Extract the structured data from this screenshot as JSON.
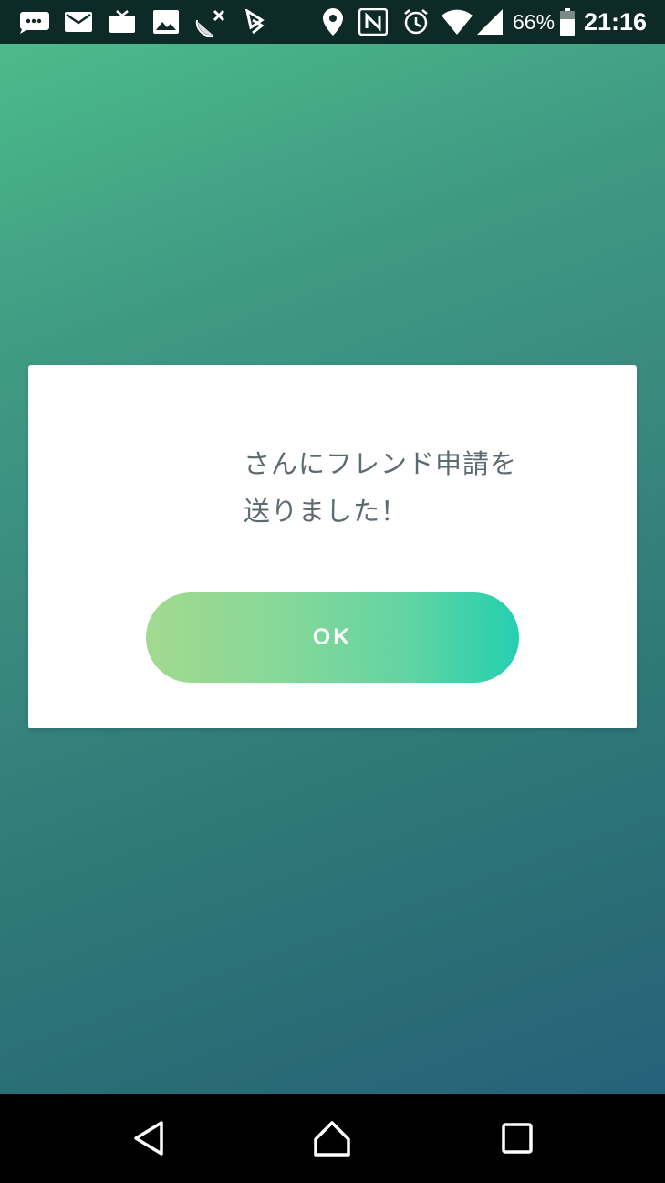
{
  "status_bar": {
    "icons": [
      "message-icon",
      "mail-icon",
      "tv-icon",
      "image-icon",
      "satellite-off-icon",
      "play-games-icon",
      "location-icon",
      "nfc-icon",
      "alarm-icon",
      "wifi-icon",
      "signal-icon",
      "battery-icon"
    ],
    "battery_percent": "66%",
    "time": "21:16"
  },
  "dialog": {
    "message_line1": "さんにフレンド申請を",
    "message_line2": "送りました！",
    "ok_label": "OK"
  },
  "nav_bar": {
    "buttons": [
      "back-icon",
      "home-icon",
      "recents-icon"
    ]
  },
  "colors": {
    "button_start": "#a3d98f",
    "button_end": "#24cfb0",
    "message_text": "#5b6b70"
  }
}
